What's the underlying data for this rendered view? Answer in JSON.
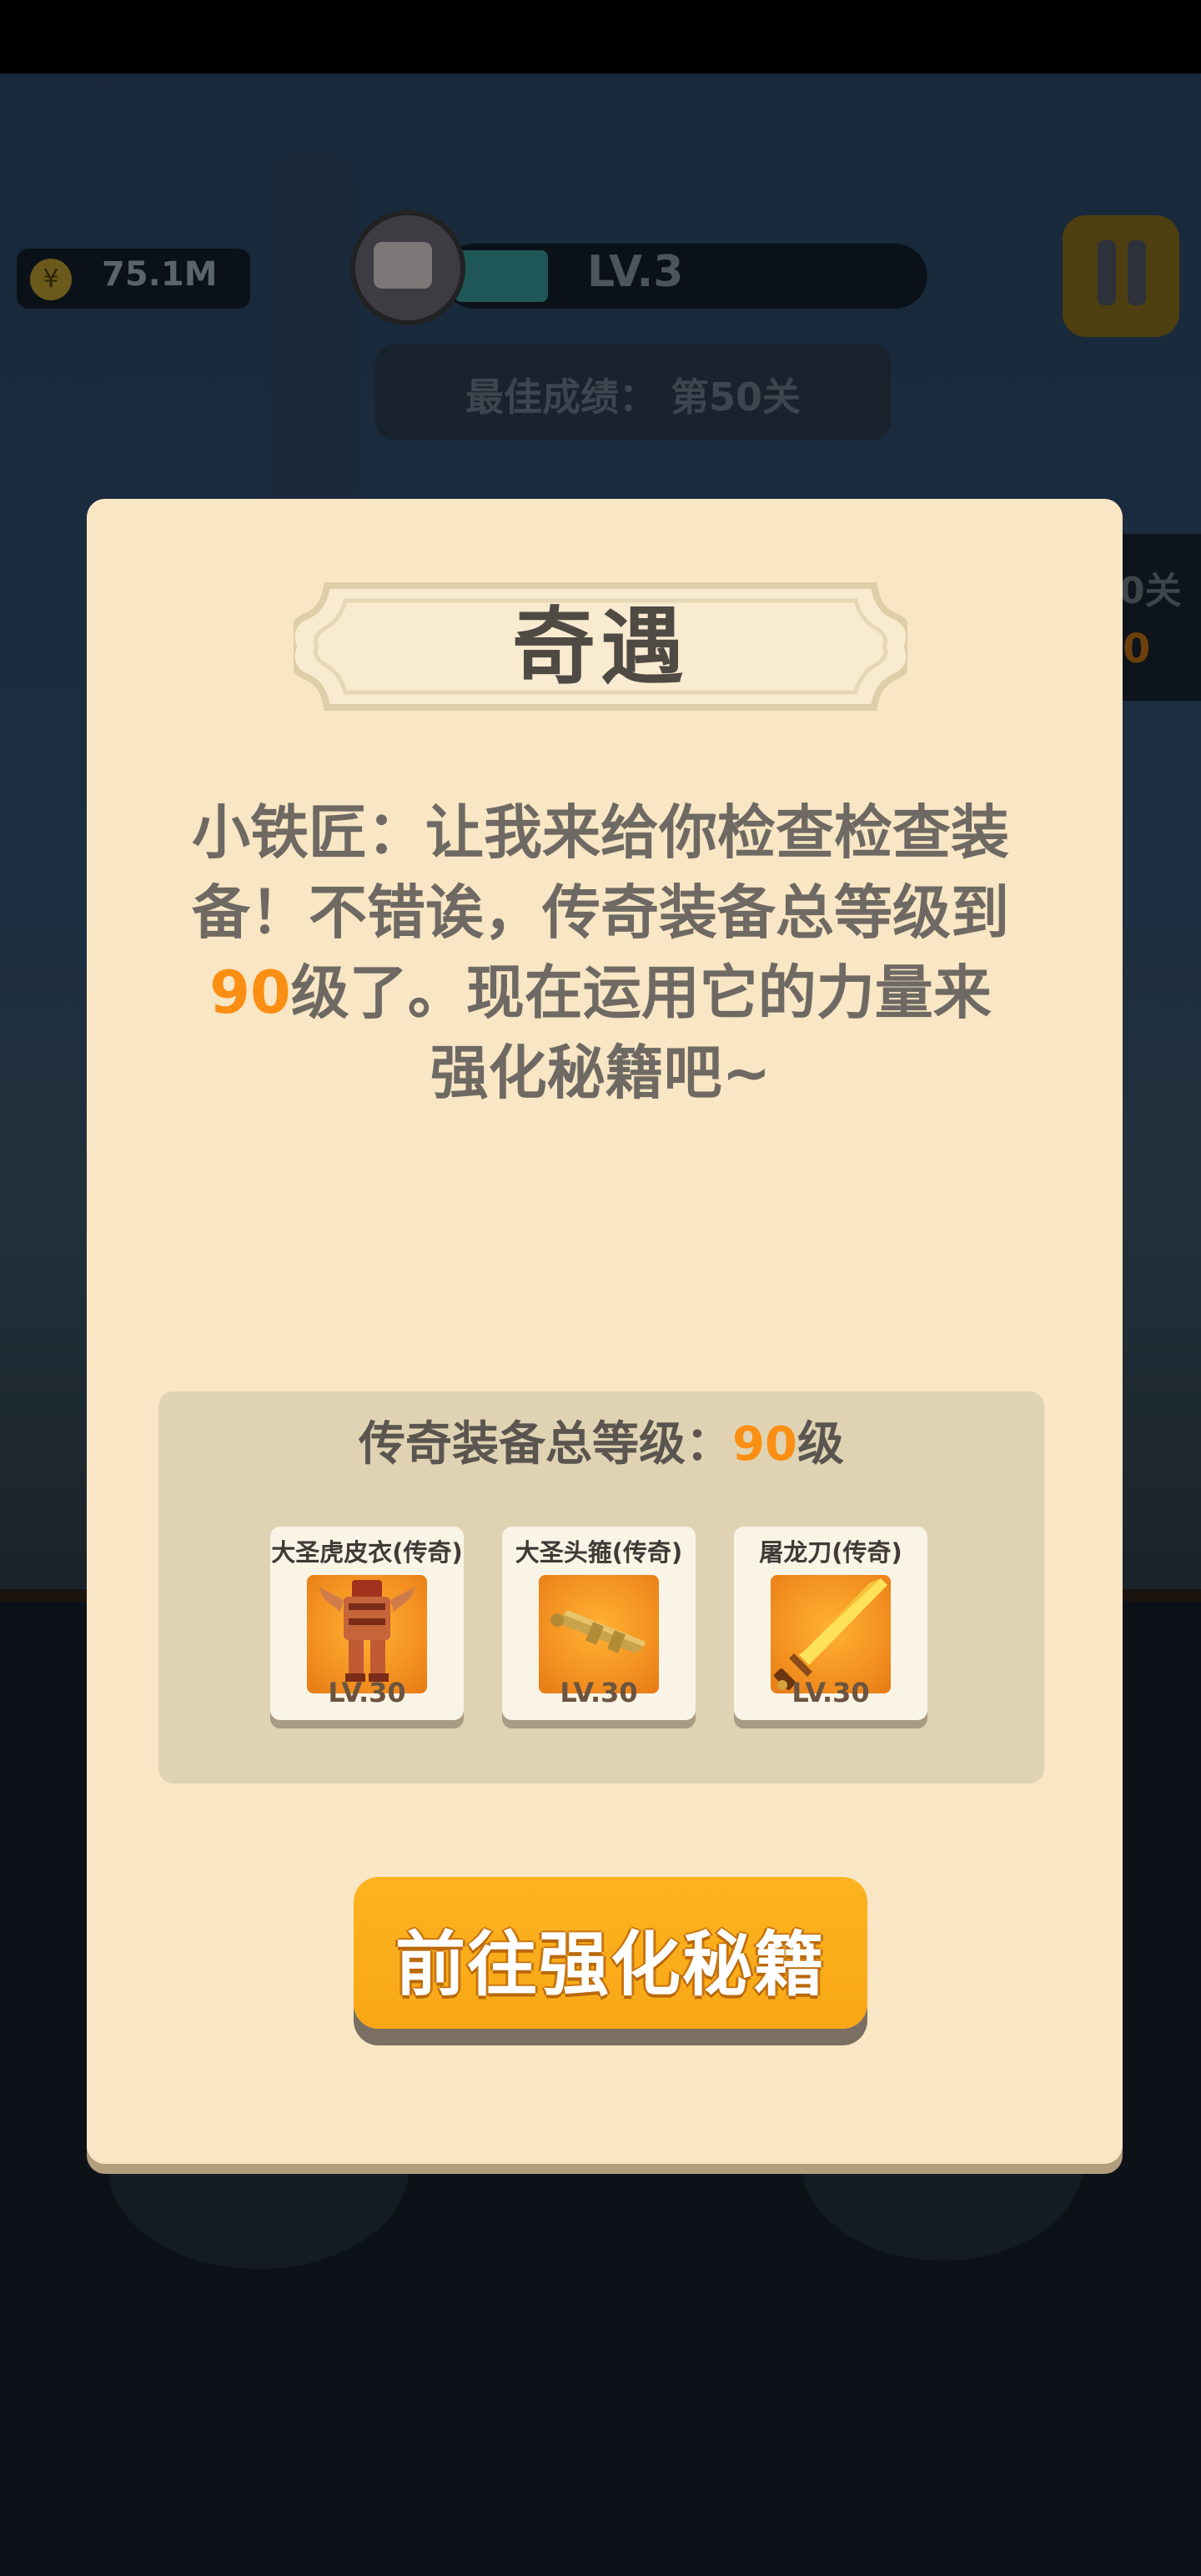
{
  "hud": {
    "coins": "75.1M",
    "level": "LV.3",
    "level_progress": 0.2,
    "best_record": "最佳成绩： 第50关",
    "side_stage": "0关",
    "side_value": "0"
  },
  "dialog": {
    "title": "奇遇",
    "story_lines": [
      "小铁匠：让我来给你检查检查装",
      "备！不错诶，传奇装备总等级到"
    ],
    "story_highlight": "90",
    "story_line3_rest": "级了。现在运用它的力量来",
    "story_line4": "强化秘籍吧~",
    "total_prefix": "传奇装备总等级：",
    "total_value": "90",
    "total_suffix": "级",
    "items": [
      {
        "name": "大圣虎皮衣(传奇)",
        "level": "LV.30",
        "icon": "tiger-armor-icon"
      },
      {
        "name": "大圣头箍(传奇)",
        "level": "LV.30",
        "icon": "golden-headband-icon"
      },
      {
        "name": "屠龙刀(传奇)",
        "level": "LV.30",
        "icon": "dragon-slayer-sword-icon"
      }
    ],
    "go_button": "前往强化秘籍"
  },
  "colors": {
    "dialog_bg": "#f8e6c4",
    "highlight": "#fb8f13",
    "button": "#fdb31f"
  }
}
